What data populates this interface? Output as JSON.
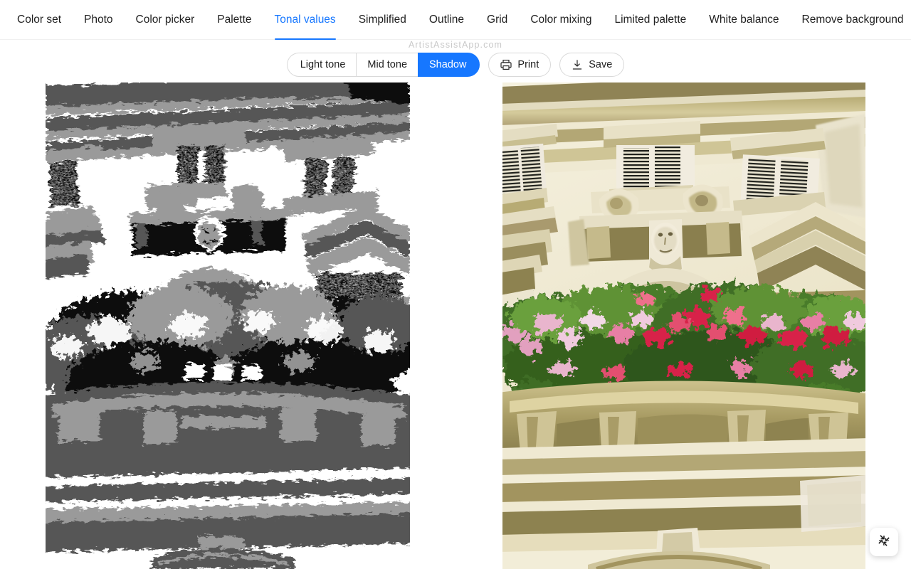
{
  "app": {
    "watermark": "ArtistAssistApp.com"
  },
  "tabs": [
    {
      "label": "Color set",
      "active": false
    },
    {
      "label": "Photo",
      "active": false
    },
    {
      "label": "Color picker",
      "active": false
    },
    {
      "label": "Palette",
      "active": false
    },
    {
      "label": "Tonal values",
      "active": true
    },
    {
      "label": "Simplified",
      "active": false
    },
    {
      "label": "Outline",
      "active": false
    },
    {
      "label": "Grid",
      "active": false
    },
    {
      "label": "Color mixing",
      "active": false
    },
    {
      "label": "Limited palette",
      "active": false
    },
    {
      "label": "White balance",
      "active": false
    },
    {
      "label": "Remove background",
      "active": false
    }
  ],
  "toolbar": {
    "segmented": [
      {
        "label": "Light tone",
        "selected": false
      },
      {
        "label": "Mid tone",
        "selected": false
      },
      {
        "label": "Shadow",
        "selected": true
      }
    ],
    "print_label": "Print",
    "save_label": "Save",
    "print_icon": "printer-icon",
    "save_icon": "download-icon"
  },
  "panes": {
    "left": {
      "name": "tonal-values-image",
      "description": "Posterized grayscale tonal-value rendering of a building facade with flower box",
      "tone_levels": [
        "#ffffff",
        "#9a9a9a",
        "#565656",
        "#0b0b0b"
      ]
    },
    "right": {
      "name": "source-photo-image",
      "description": "Original colour photo of a cream stone building facade with shuttered windows, carved face keystone and cascading pink and red geraniums",
      "key_colors": {
        "sky": "#2a86c8",
        "wall": "#efe9d2",
        "stone_shadow": "#a99a6e",
        "leaf": "#4a7c2b",
        "flower_red": "#d8234a",
        "flower_pink": "#e77fa5",
        "roof": "#a8643f"
      }
    }
  },
  "fullscreen_button": {
    "icon": "compress-arrows-icon",
    "title": "Exit full screen"
  }
}
